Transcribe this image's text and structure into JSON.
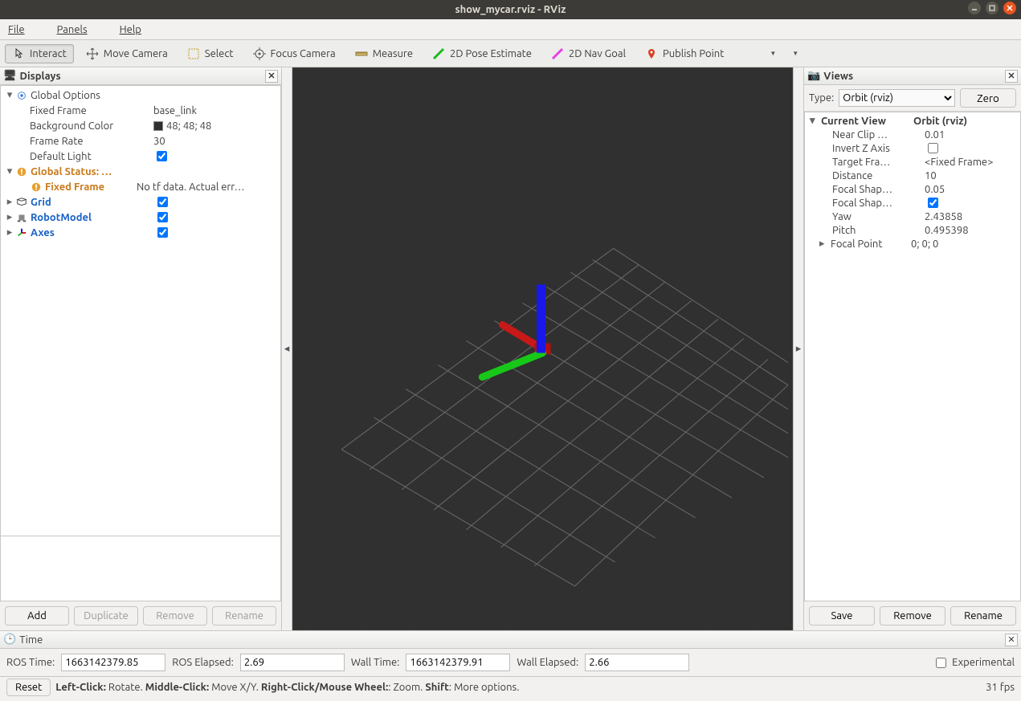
{
  "window": {
    "title": "show_mycar.rviz - RViz"
  },
  "menu": {
    "file": "File",
    "panels": "Panels",
    "help": "Help"
  },
  "toolbar": {
    "interact": "Interact",
    "move_camera": "Move Camera",
    "select": "Select",
    "focus_camera": "Focus Camera",
    "measure": "Measure",
    "pose_estimate": "2D Pose Estimate",
    "nav_goal": "2D Nav Goal",
    "publish_point": "Publish Point"
  },
  "left_panel": {
    "title": "Displays",
    "global_options": {
      "label": "Global Options",
      "fixed_frame": {
        "label": "Fixed Frame",
        "value": "base_link"
      },
      "bg_color": {
        "label": "Background Color",
        "value": "48; 48; 48",
        "hex": "#303030"
      },
      "frame_rate": {
        "label": "Frame Rate",
        "value": "30"
      },
      "default_light": {
        "label": "Default Light",
        "value": true
      }
    },
    "global_status": {
      "label": "Global Status: …",
      "fixed_frame": {
        "label": "Fixed Frame",
        "value": "No tf data.  Actual err…"
      }
    },
    "items": {
      "grid": "Grid",
      "robot_model": "RobotModel",
      "axes": "Axes"
    },
    "buttons": {
      "add": "Add",
      "duplicate": "Duplicate",
      "remove": "Remove",
      "rename": "Rename"
    }
  },
  "views_panel": {
    "title": "Views",
    "type_label": "Type:",
    "type_value": "Orbit (rviz)",
    "zero": "Zero",
    "current_view": {
      "label": "Current View",
      "value": "Orbit (rviz)"
    },
    "props": {
      "near_clip": {
        "label": "Near Clip …",
        "value": "0.01"
      },
      "invert_z": {
        "label": "Invert Z Axis",
        "value": false
      },
      "target_frame": {
        "label": "Target Fra…",
        "value": "<Fixed Frame>"
      },
      "distance": {
        "label": "Distance",
        "value": "10"
      },
      "focal_size": {
        "label": "Focal Shap…",
        "value": "0.05"
      },
      "focal_fixed": {
        "label": "Focal Shap…",
        "value": true
      },
      "yaw": {
        "label": "Yaw",
        "value": "2.43858"
      },
      "pitch": {
        "label": "Pitch",
        "value": "0.495398"
      },
      "focal_point": {
        "label": "Focal Point",
        "value": "0; 0; 0"
      }
    },
    "buttons": {
      "save": "Save",
      "remove": "Remove",
      "rename": "Rename"
    }
  },
  "time_panel": {
    "title": "Time",
    "ros_time": {
      "label": "ROS Time:",
      "value": "1663142379.85"
    },
    "ros_elapsed": {
      "label": "ROS Elapsed:",
      "value": "2.69"
    },
    "wall_time": {
      "label": "Wall Time:",
      "value": "1663142379.91"
    },
    "wall_elapsed": {
      "label": "Wall Elapsed:",
      "value": "2.66"
    },
    "experimental": "Experimental"
  },
  "status": {
    "reset": "Reset",
    "hint_prefix": "Left-Click:",
    "hint1": " Rotate. ",
    "hint_prefix2": "Middle-Click:",
    "hint2": " Move X/Y. ",
    "hint_prefix3": "Right-Click/Mouse Wheel:",
    "hint3": ": Zoom. ",
    "hint_prefix4": "Shift",
    "hint4": ": More options.",
    "fps": "31 fps"
  }
}
